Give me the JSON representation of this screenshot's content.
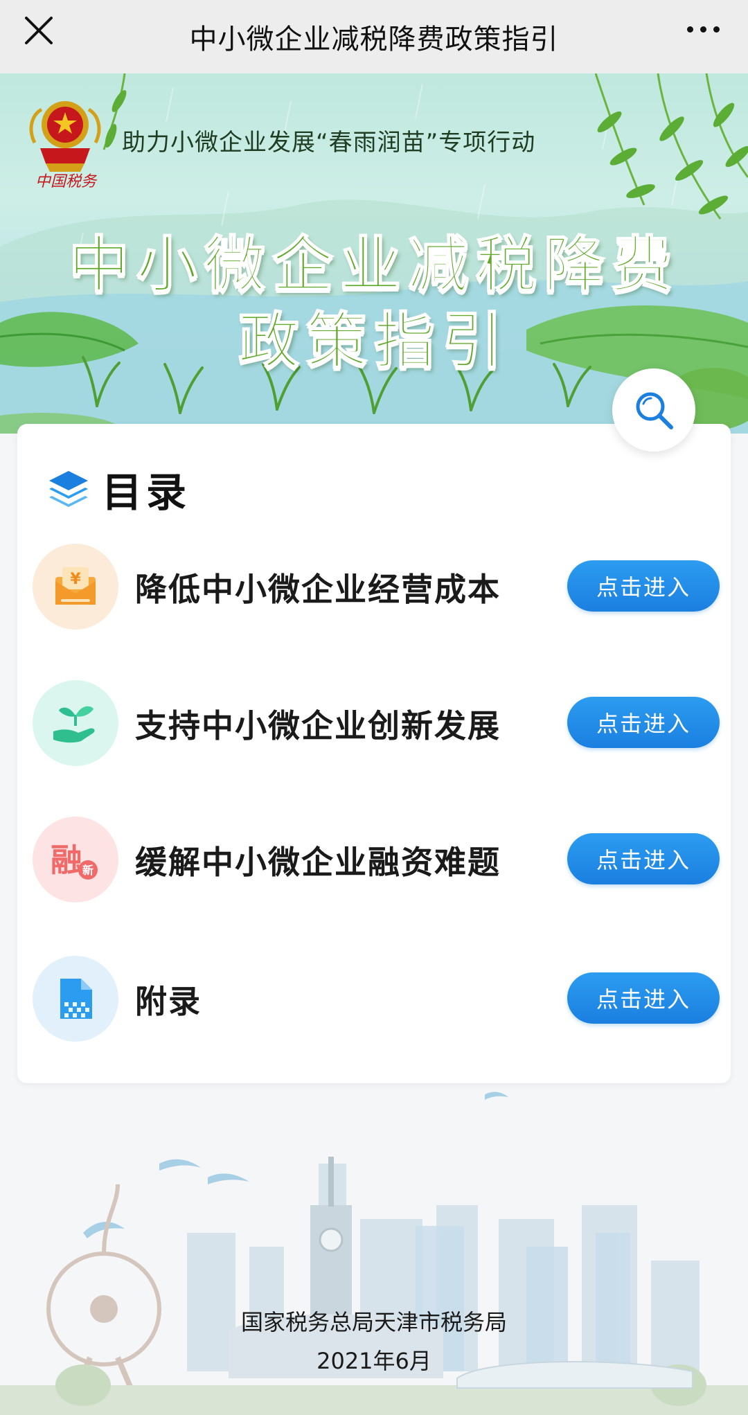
{
  "titlebar": {
    "title": "中小微企业减税降费政策指引",
    "close_icon": "close-icon",
    "more_icon": "more-icon"
  },
  "banner": {
    "emblem_text": "中国税务",
    "subtitle": "助力小微企业发展“春雨润苗”专项行动",
    "title_line1": "中小微企业减税降费",
    "title_line2": "政策指引"
  },
  "search": {
    "icon": "search-icon"
  },
  "catalog": {
    "heading": "目录",
    "items": [
      {
        "label": "降低中小微企业经营成本",
        "button": "点击进入",
        "icon": "envelope-yuan-icon"
      },
      {
        "label": "支持中小微企业创新发展",
        "button": "点击进入",
        "icon": "hand-sprout-icon"
      },
      {
        "label": "缓解中小微企业融资难题",
        "button": "点击进入",
        "icon": "rong-xin-icon"
      },
      {
        "label": "附录",
        "button": "点击进入",
        "icon": "document-icon"
      }
    ],
    "item4_icon_text": [
      "融",
      "新"
    ]
  },
  "footer": {
    "org": "国家税务总局天津市税务局",
    "date": "2021年6月"
  },
  "colors": {
    "accent_blue": "#1b7fe0",
    "title_green": "#5fa82a",
    "titlebar_bg": "#ededed"
  }
}
